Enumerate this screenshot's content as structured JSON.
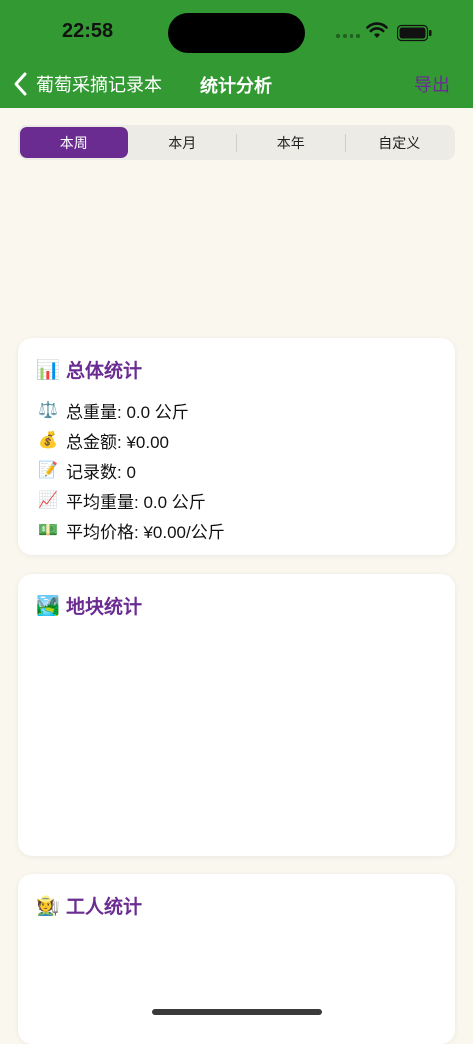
{
  "status_bar": {
    "time": "22:58"
  },
  "nav": {
    "back_label": "葡萄采摘记录本",
    "title": "统计分析",
    "export_label": "导出"
  },
  "segments": [
    {
      "label": "本周"
    },
    {
      "label": "本月"
    },
    {
      "label": "本年"
    },
    {
      "label": "自定义"
    }
  ],
  "overall": {
    "icon": "📊",
    "title": "总体统计",
    "rows": [
      {
        "icon": "⚖️",
        "text": "总重量: 0.0 公斤"
      },
      {
        "icon": "💰",
        "text": "总金额: ¥0.00"
      },
      {
        "icon": "📝",
        "text": "记录数: 0"
      },
      {
        "icon": "📈",
        "text": "平均重量: 0.0 公斤"
      },
      {
        "icon": "💵",
        "text": "平均价格: ¥0.00/公斤"
      }
    ]
  },
  "plots": {
    "icon": "🏞️",
    "title": "地块统计"
  },
  "workers": {
    "icon": "🧑‍🌾",
    "title": "工人统计"
  },
  "colors": {
    "header_green": "#339933",
    "accent_purple": "#6a2c91",
    "background": "#f9f7ee"
  }
}
